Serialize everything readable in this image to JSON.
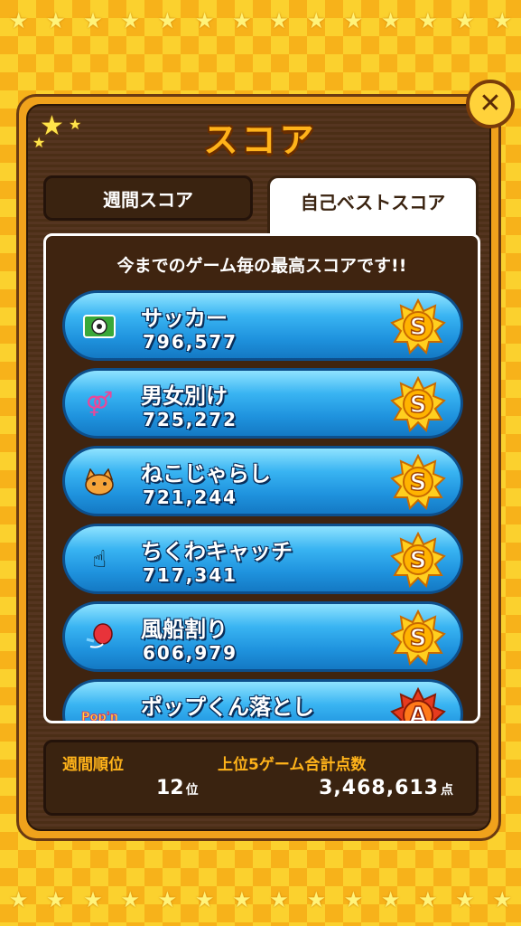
{
  "title": "スコア",
  "tabs": {
    "weekly": "週間スコア",
    "best": "自己ベストスコア"
  },
  "subtitle": "今までのゲーム毎の最高スコアです!!",
  "games": [
    {
      "name": "サッカー",
      "score": "796,577",
      "rank": "S",
      "icon": "soccer-field-icon"
    },
    {
      "name": "男女別け",
      "score": "725,272",
      "rank": "S",
      "icon": "gender-symbols-icon"
    },
    {
      "name": "ねこじゃらし",
      "score": "721,244",
      "rank": "S",
      "icon": "cat-face-icon"
    },
    {
      "name": "ちくわキャッチ",
      "score": "717,341",
      "rank": "S",
      "icon": "pointing-hand-icon"
    },
    {
      "name": "風船割り",
      "score": "606,979",
      "rank": "S",
      "icon": "balloon-icon"
    },
    {
      "name": "ポップくん落とし",
      "score": "",
      "rank": "A",
      "icon": "popn-logo-icon"
    }
  ],
  "footer": {
    "rank_label": "週間順位",
    "rank_value": "12",
    "rank_unit": "位",
    "total_label": "上位5ゲーム合計点数",
    "total_value": "3,468,613",
    "total_unit": "点"
  },
  "colors": {
    "row_blue": "#1f93de",
    "badge_s": "#ffcf1f",
    "badge_a": "#e63b1f",
    "accent_orange": "#ffb31a",
    "panel_brown": "#4b2e16"
  }
}
